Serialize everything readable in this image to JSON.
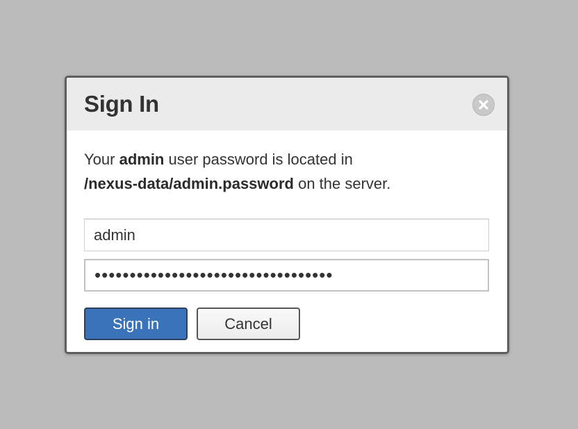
{
  "dialog": {
    "title": "Sign In",
    "close_icon": "close-circle-icon",
    "message": {
      "prefix": "Your ",
      "username_emphasis": "admin",
      "middle": " user password is located in",
      "path_emphasis": "/nexus-data/admin.password",
      "suffix": " on the server."
    },
    "username_value": "admin",
    "password_value": "••••••••••••••••••••••••••••••••••",
    "sign_in_label": "Sign in",
    "cancel_label": "Cancel"
  },
  "colors": {
    "backdrop": "#bbbbbb",
    "header": "#ebebeb",
    "primary_button": "#3a73ba",
    "text": "#333333"
  }
}
